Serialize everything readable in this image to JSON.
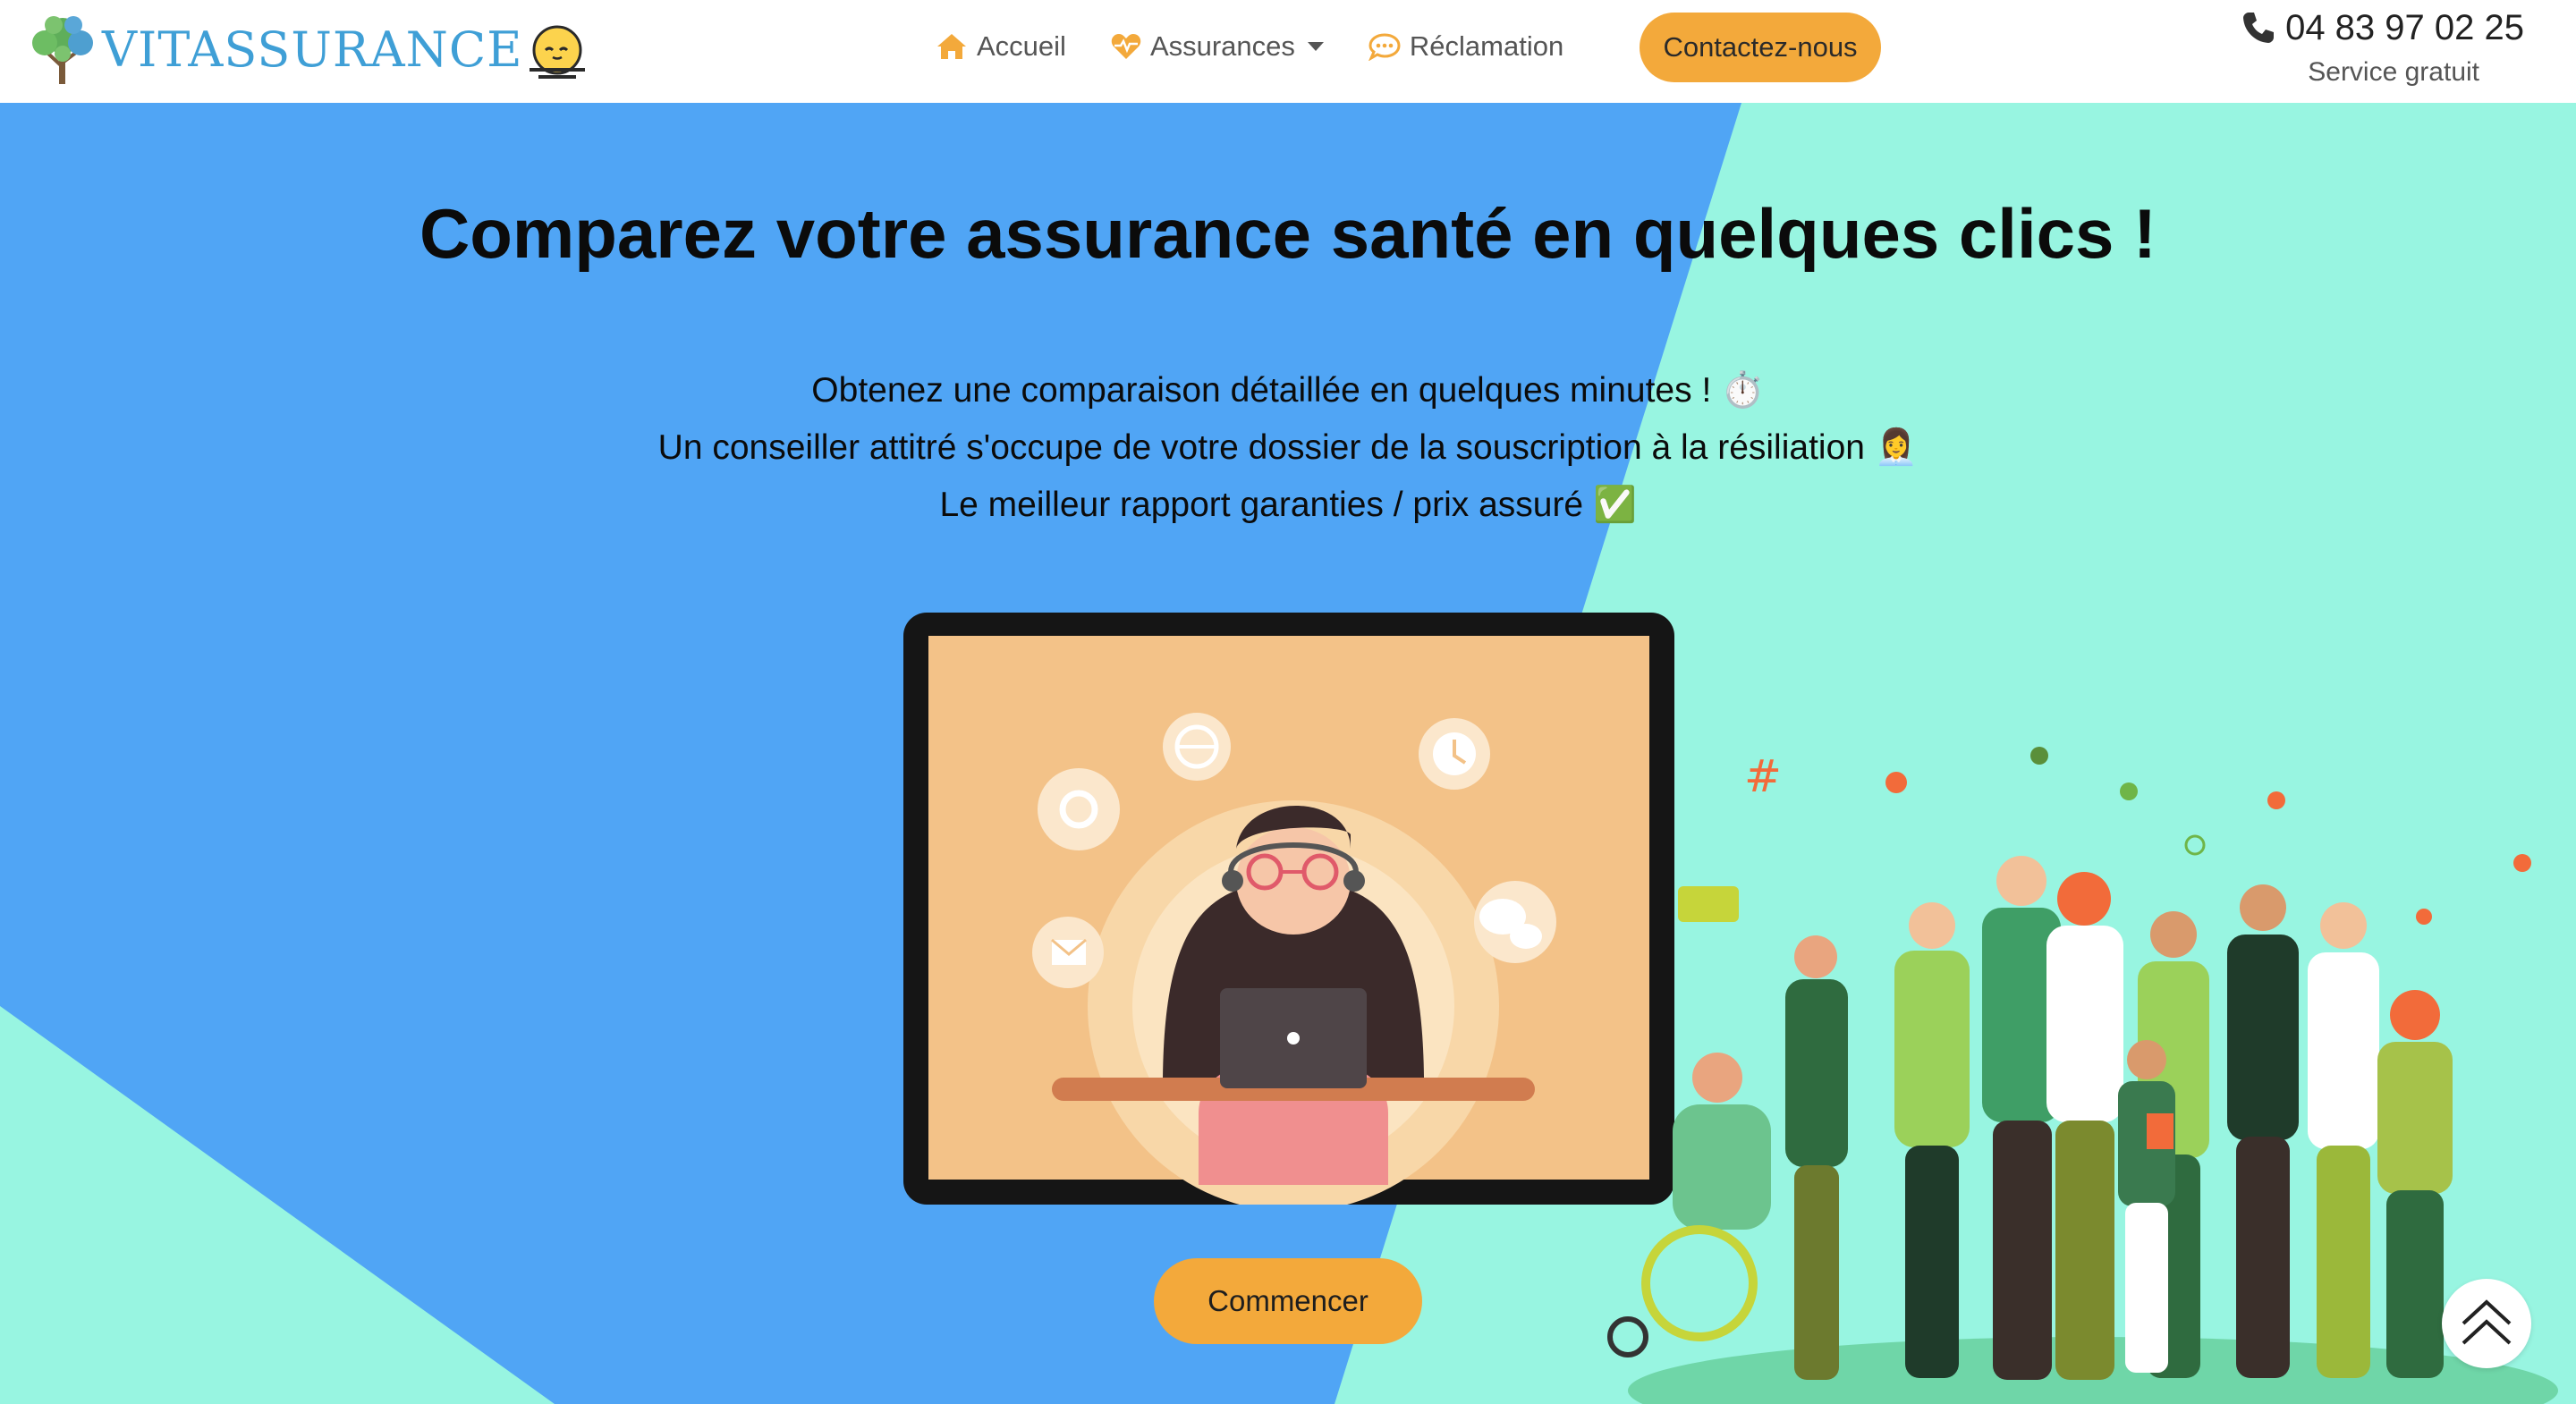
{
  "brand": {
    "name": "VITASSURANCE",
    "logo_icon": "tree-icon",
    "theme_toggle_icon": "sunset-icon"
  },
  "nav": {
    "items": [
      {
        "label": "Accueil",
        "icon": "home-icon"
      },
      {
        "label": "Assurances",
        "icon": "heartbeat-icon",
        "has_dropdown": true
      },
      {
        "label": "Réclamation",
        "icon": "comment-icon"
      }
    ],
    "contact_button": "Contactez-nous"
  },
  "phone": {
    "number": "04 83 97 02 25",
    "subtitle": "Service gratuit",
    "icon": "phone-icon"
  },
  "hero": {
    "title": "Comparez votre assurance santé en quelques clics !",
    "lines": [
      "Obtenez une comparaison détaillée en quelques minutes ! ⏱️",
      "Un conseiller attitré s'occupe de votre dossier de la souscription à la résiliation 👩‍💼",
      "Le meilleur rapport garanties / prix assuré ✅"
    ],
    "cta": "Commencer",
    "illustration": "support-agent-tablet-illustration",
    "people_illustration": "diverse-people-group-illustration"
  },
  "scroll_top_icon": "double-chevron-up-icon",
  "colors": {
    "accent": "#f3a93b",
    "hero_blue": "#50a5f5",
    "hero_mint": "#98f5e1",
    "brand_blue": "#3f9fd6",
    "tablet_screen": "#f3c288"
  }
}
